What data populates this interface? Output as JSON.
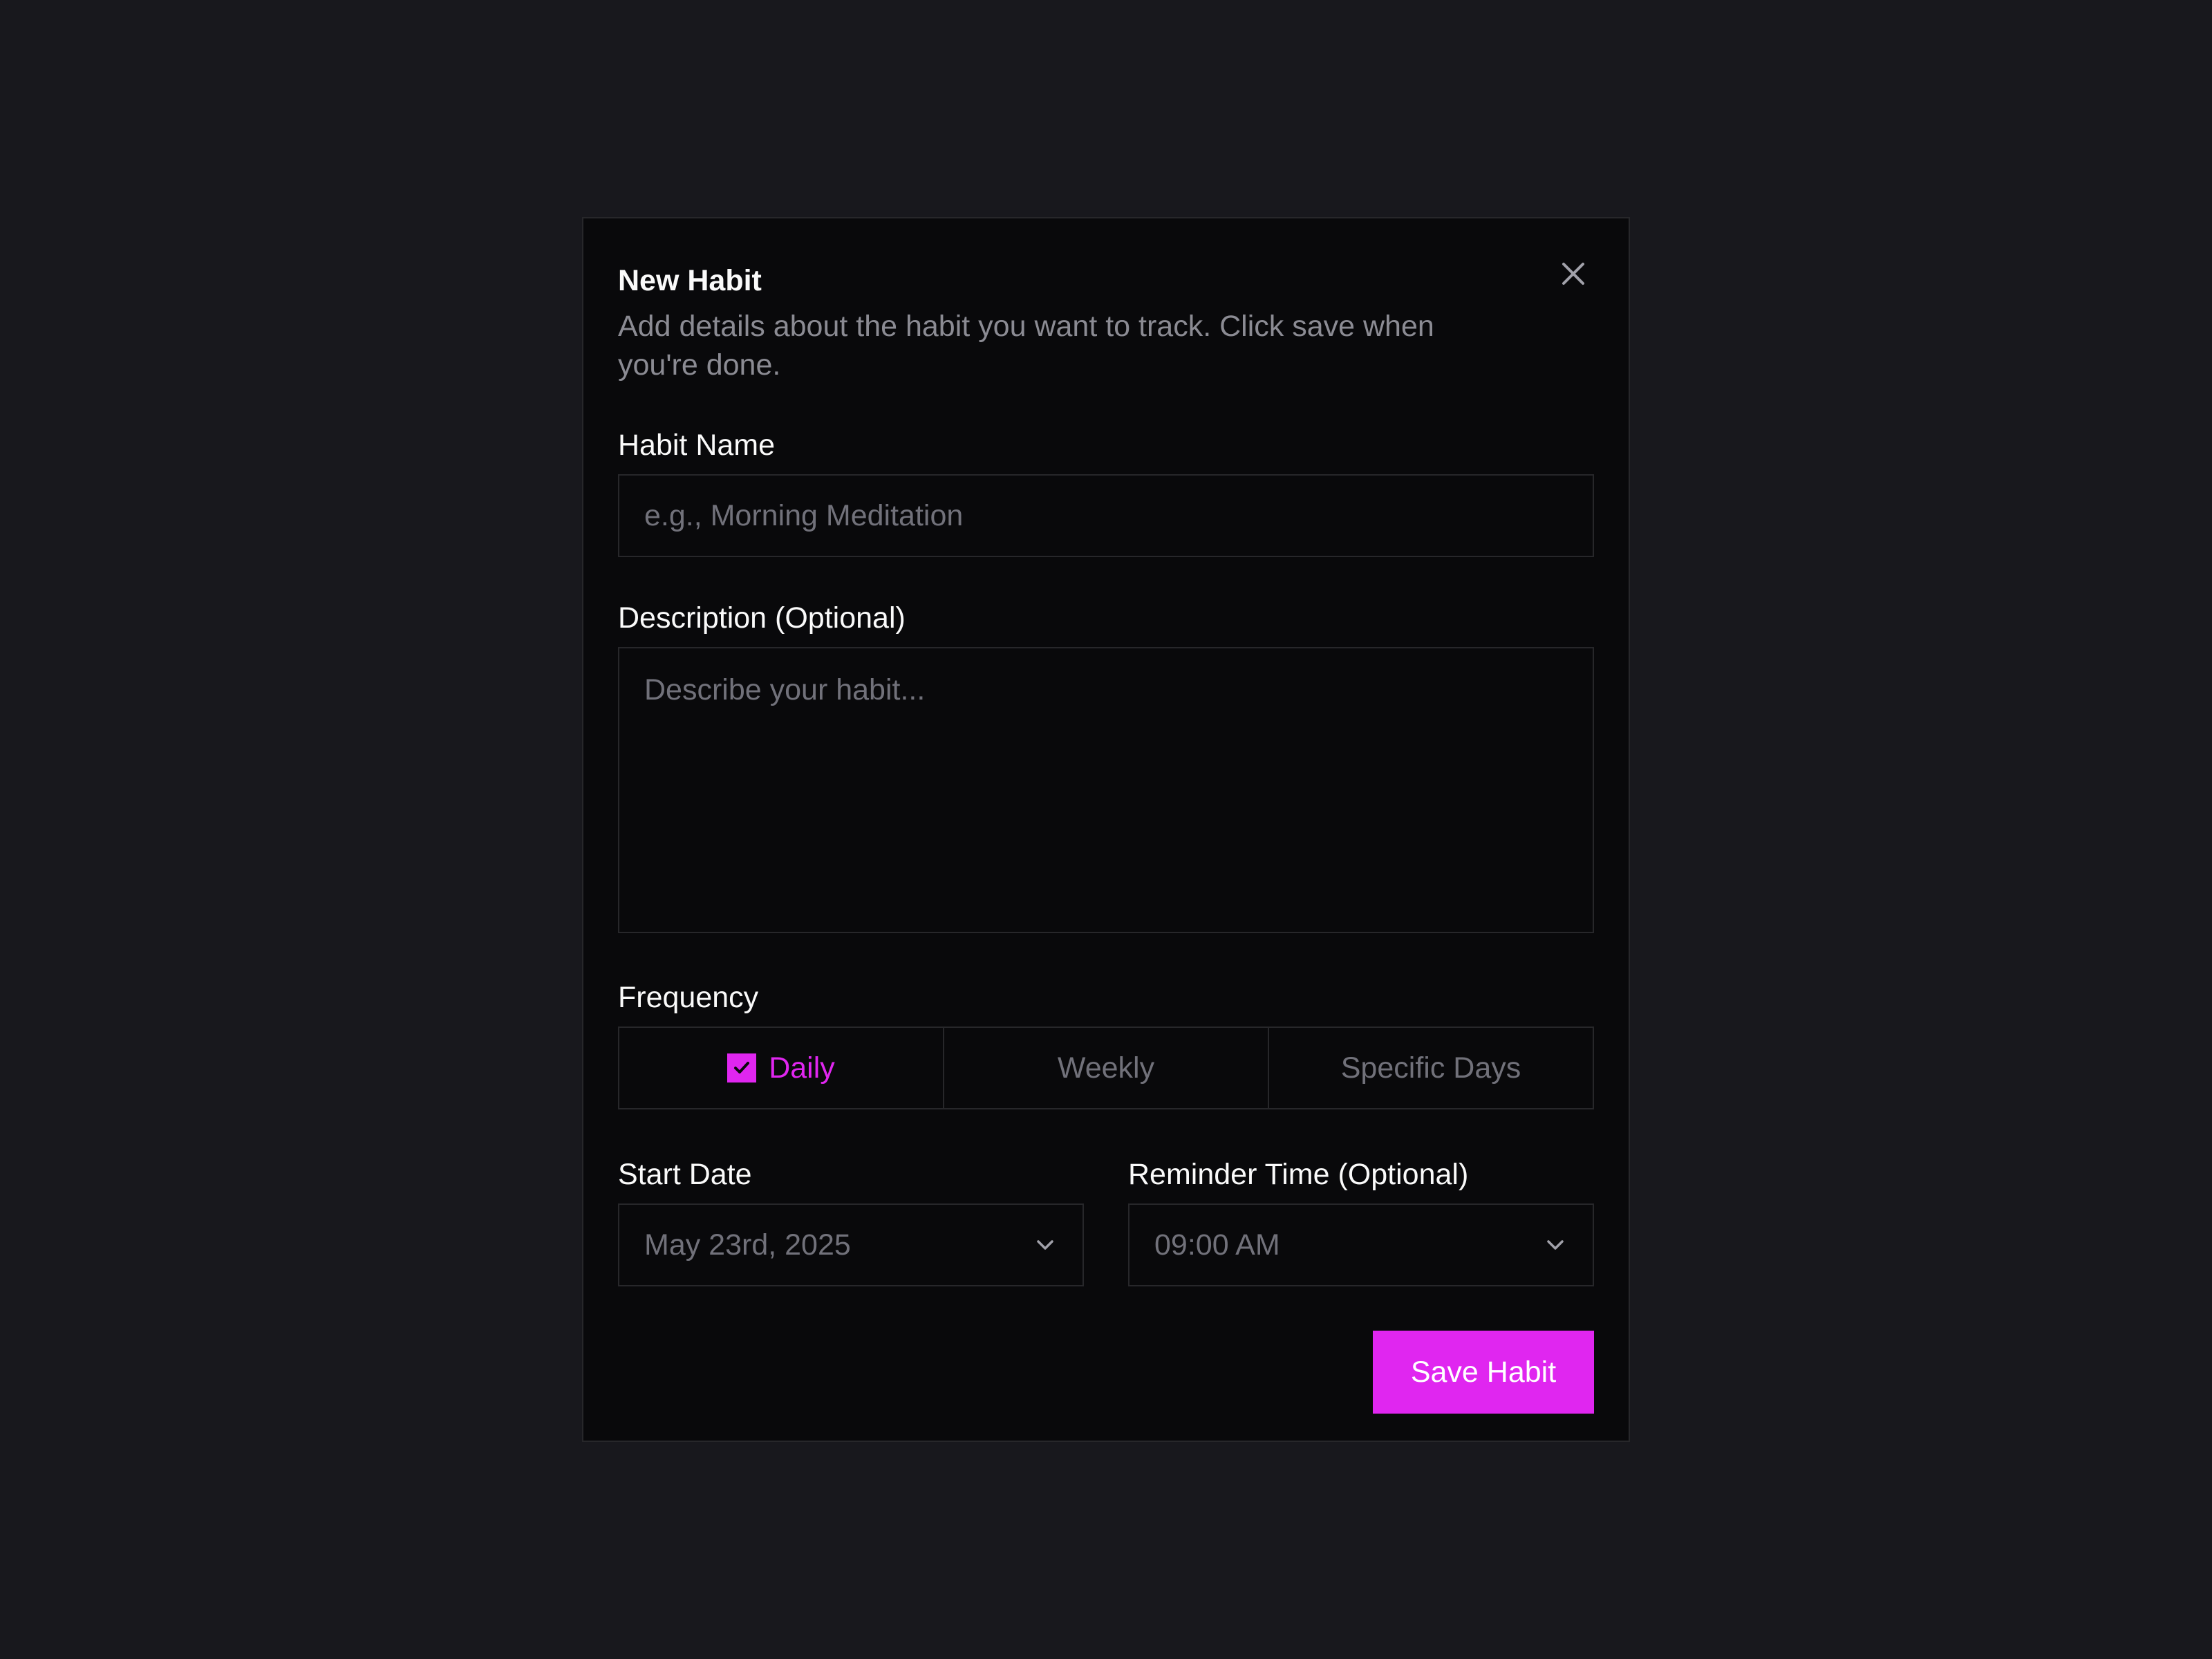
{
  "dialog": {
    "title": "New Habit",
    "subtitle": "Add details about the habit you want to track. Click save when you're done.",
    "close_icon": "close-icon"
  },
  "form": {
    "habit_name": {
      "label": "Habit Name",
      "placeholder": "e.g., Morning Meditation",
      "value": ""
    },
    "description": {
      "label": "Description (Optional)",
      "placeholder": "Describe your habit...",
      "value": ""
    },
    "frequency": {
      "label": "Frequency",
      "options": [
        {
          "label": "Daily",
          "selected": true
        },
        {
          "label": "Weekly",
          "selected": false
        },
        {
          "label": "Specific Days",
          "selected": false
        }
      ]
    },
    "start_date": {
      "label": "Start Date",
      "value": "May 23rd, 2025"
    },
    "reminder_time": {
      "label": "Reminder Time (Optional)",
      "value": "09:00 AM"
    }
  },
  "actions": {
    "save_label": "Save Habit"
  },
  "colors": {
    "accent": "#e026f0",
    "background": "#18181d",
    "surface": "#09090b",
    "border": "#27272a",
    "muted": "#71717a"
  }
}
